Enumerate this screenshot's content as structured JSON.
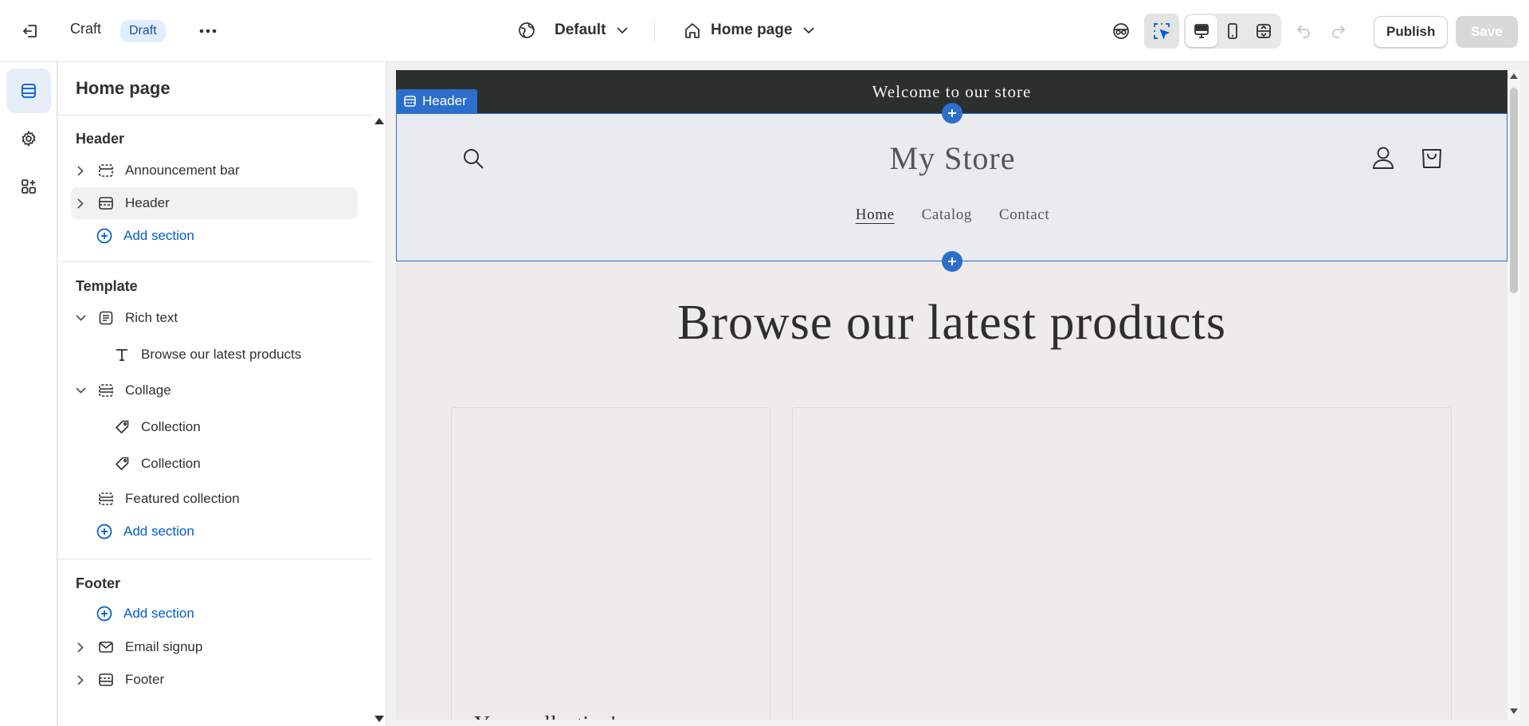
{
  "topbar": {
    "app_name": "Craft",
    "status_badge": "Draft",
    "theme_selector": "Default",
    "page_selector": "Home page",
    "publish_label": "Publish",
    "save_label": "Save"
  },
  "icons": [
    "exit-icon",
    "more-icon",
    "globe-icon",
    "home-icon",
    "chevron-down-icon",
    "inspector-icon",
    "select-icon",
    "desktop-icon",
    "mobile-icon",
    "fullwidth-icon",
    "undo-icon",
    "redo-icon",
    "sections-icon",
    "settings-icon",
    "apps-icon",
    "search-icon",
    "account-icon",
    "cart-icon"
  ],
  "sidebar": {
    "title": "Home page",
    "header_group": {
      "title": "Header",
      "items": [
        {
          "label": "Announcement bar"
        },
        {
          "label": "Header"
        }
      ],
      "add_label": "Add section"
    },
    "template_group": {
      "title": "Template",
      "rich_text": {
        "label": "Rich text",
        "child": "Browse our latest products"
      },
      "collage": {
        "label": "Collage",
        "children": [
          "Collection",
          "Collection"
        ]
      },
      "featured": {
        "label": "Featured collection"
      },
      "add_label": "Add section"
    },
    "footer_group": {
      "title": "Footer",
      "add_label": "Add section",
      "items": [
        {
          "label": "Email signup"
        },
        {
          "label": "Footer"
        }
      ]
    }
  },
  "preview": {
    "announcement": "Welcome to our store",
    "header_tag": "Header",
    "store_name": "My Store",
    "nav": [
      "Home",
      "Catalog",
      "Contact"
    ],
    "headline": "Browse our latest products",
    "card_text": "Your collection's"
  },
  "colors": {
    "accent": "#2c6ecb",
    "link": "#005bd3",
    "announcement_bg": "#2b302e"
  }
}
